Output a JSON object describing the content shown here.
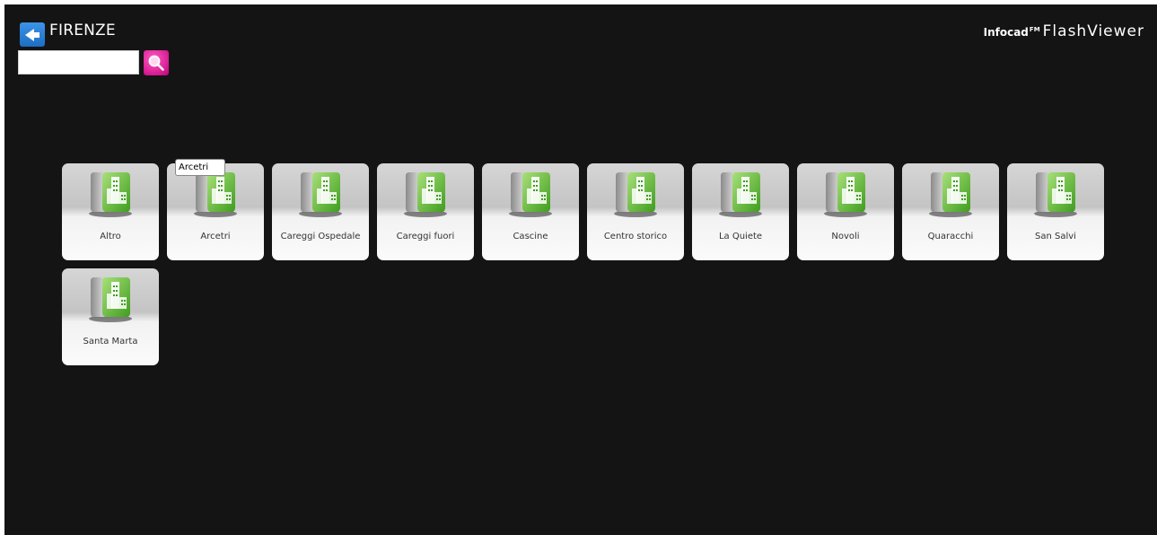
{
  "header": {
    "back_icon": "arrow-left-icon",
    "title": "FIRENZE",
    "accent_color": "#2a82d8"
  },
  "search": {
    "value": "",
    "placeholder": "",
    "button_icon": "magnifier-icon",
    "button_color": "#e2149a"
  },
  "brand": {
    "name": "Infocad",
    "superscript": "FM",
    "product": "FlashViewer"
  },
  "tooltip": {
    "text": "Arcetri"
  },
  "tiles": [
    {
      "label": "Altro",
      "icon": "building-icon"
    },
    {
      "label": "Arcetri",
      "icon": "building-icon"
    },
    {
      "label": "Careggi Ospedale",
      "icon": "building-icon"
    },
    {
      "label": "Careggi fuori",
      "icon": "building-icon"
    },
    {
      "label": "Cascine",
      "icon": "building-icon"
    },
    {
      "label": "Centro storico",
      "icon": "building-icon"
    },
    {
      "label": "La Quiete",
      "icon": "building-icon"
    },
    {
      "label": "Novoli",
      "icon": "building-icon"
    },
    {
      "label": "Quaracchi",
      "icon": "building-icon"
    },
    {
      "label": "San Salvi",
      "icon": "building-icon"
    },
    {
      "label": "Santa Marta",
      "icon": "building-icon"
    }
  ]
}
